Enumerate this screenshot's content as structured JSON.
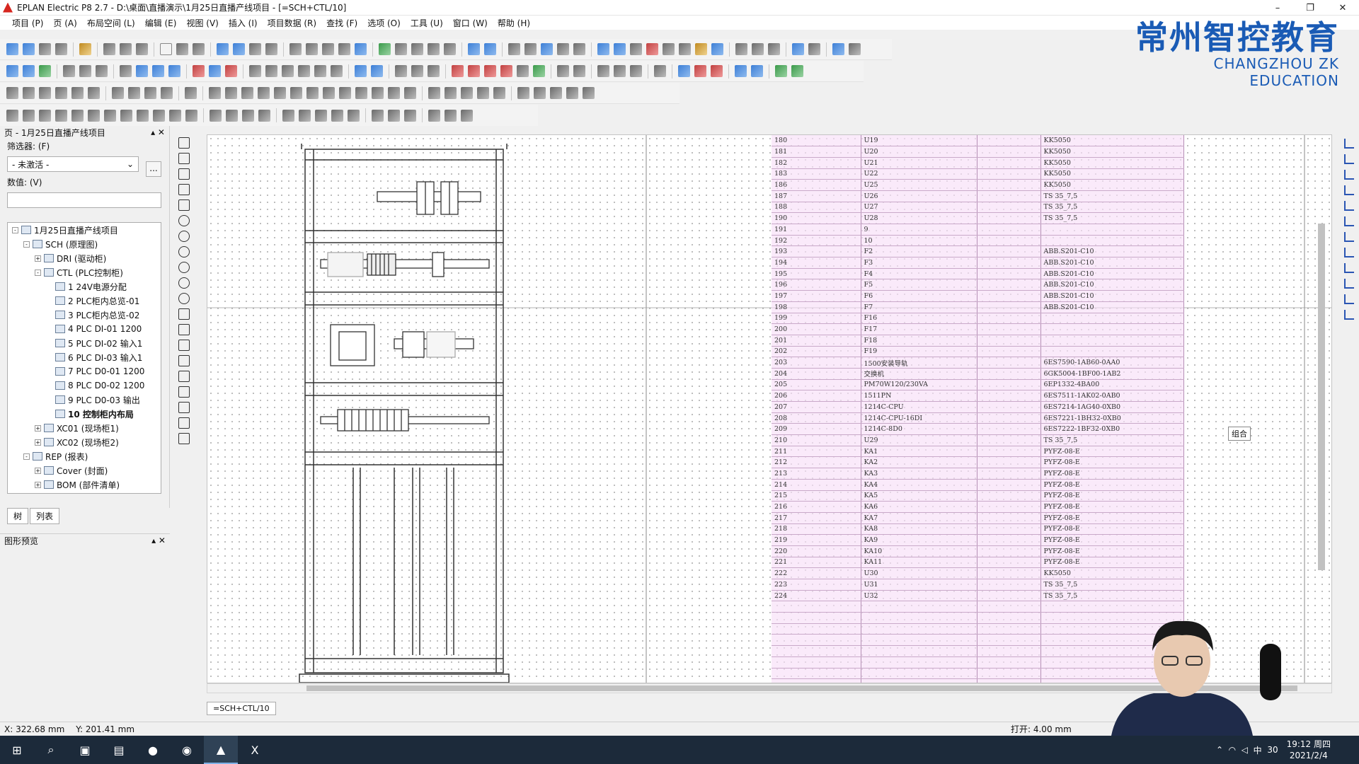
{
  "window": {
    "title": "EPLAN Electric P8 2.7 - D:\\桌面\\直播演示\\1月25日直播产线项目 - [=SCH+CTL/10]",
    "controls": [
      "–",
      "❐",
      "✕"
    ]
  },
  "menu": [
    "项目 (P)",
    "页 (A)",
    "布局空间 (L)",
    "编辑 (E)",
    "视图 (V)",
    "插入 (I)",
    "项目数据 (R)",
    "查找 (F)",
    "选项 (O)",
    "工具 (U)",
    "窗口 (W)",
    "帮助 (H)"
  ],
  "logo": {
    "cn": "常州智控教育",
    "en": "CHANGZHOU ZK EDUCATION",
    "color": "#1a5bb5"
  },
  "pages_panel": {
    "title": "页 - 1月25日直播产线项目",
    "filter_label": "筛选器: (F)",
    "filter_value": "- 未激活 -",
    "more_button": "...",
    "value_label": "数值: (V)",
    "tree": [
      {
        "label": "1月25日直播产线项目",
        "level": 0,
        "exp": "-"
      },
      {
        "label": "SCH (原理图)",
        "level": 1,
        "exp": "-"
      },
      {
        "label": "DRI (驱动柜)",
        "level": 2,
        "exp": "+"
      },
      {
        "label": "CTL (PLC控制柜)",
        "level": 2,
        "exp": "-"
      },
      {
        "label": "1 24V电源分配",
        "level": 3,
        "exp": ""
      },
      {
        "label": "2 PLC柜内总览-01",
        "level": 3,
        "exp": ""
      },
      {
        "label": "3 PLC柜内总览-02",
        "level": 3,
        "exp": ""
      },
      {
        "label": "4 PLC DI-01 1200",
        "level": 3,
        "exp": ""
      },
      {
        "label": "5 PLC DI-02 输入1",
        "level": 3,
        "exp": ""
      },
      {
        "label": "6 PLC DI-03 输入1",
        "level": 3,
        "exp": ""
      },
      {
        "label": "7 PLC D0-01 1200",
        "level": 3,
        "exp": ""
      },
      {
        "label": "8 PLC D0-02 1200",
        "level": 3,
        "exp": ""
      },
      {
        "label": "9 PLC D0-03 输出",
        "level": 3,
        "exp": ""
      },
      {
        "label": "10 控制柜内布局",
        "level": 3,
        "exp": "",
        "selected": true
      },
      {
        "label": "XC01 (现场柜1)",
        "level": 2,
        "exp": "+"
      },
      {
        "label": "XC02 (现场柜2)",
        "level": 2,
        "exp": "+"
      },
      {
        "label": "REP (报表)",
        "level": 1,
        "exp": "-"
      },
      {
        "label": "Cover (封面)",
        "level": 2,
        "exp": "+"
      },
      {
        "label": "BOM (部件清单)",
        "level": 2,
        "exp": "+"
      }
    ],
    "tabs": [
      "树",
      "列表"
    ]
  },
  "preview_panel": {
    "title": "图形预览"
  },
  "page_tab": "=SCH+CTL/10",
  "tooltip": "组合",
  "bom_rows": [
    [
      "180",
      "U19",
      "KK5050"
    ],
    [
      "181",
      "U20",
      "KK5050"
    ],
    [
      "182",
      "U21",
      "KK5050"
    ],
    [
      "183",
      "U22",
      "KK5050"
    ],
    [
      "186",
      "U25",
      "KK5050"
    ],
    [
      "187",
      "U26",
      "TS 35_7,5"
    ],
    [
      "188",
      "U27",
      "TS 35_7,5"
    ],
    [
      "190",
      "U28",
      "TS 35_7,5"
    ],
    [
      "191",
      "9",
      ""
    ],
    [
      "192",
      "10",
      ""
    ],
    [
      "193",
      "F2",
      "ABB.S201-C10"
    ],
    [
      "194",
      "F3",
      "ABB.S201-C10"
    ],
    [
      "195",
      "F4",
      "ABB.S201-C10"
    ],
    [
      "196",
      "F5",
      "ABB.S201-C10"
    ],
    [
      "197",
      "F6",
      "ABB.S201-C10"
    ],
    [
      "198",
      "F7",
      "ABB.S201-C10"
    ],
    [
      "199",
      "F16",
      ""
    ],
    [
      "200",
      "F17",
      ""
    ],
    [
      "201",
      "F18",
      ""
    ],
    [
      "202",
      "F19",
      ""
    ],
    [
      "203",
      "1500安装导轨",
      "6ES7590-1AB60-0AA0"
    ],
    [
      "204",
      "交换机",
      "6GK5004-1BF00-1AB2"
    ],
    [
      "205",
      "PM70W120/230VA",
      "6EP1332-4BA00"
    ],
    [
      "206",
      "1511PN",
      "6ES7511-1AK02-0AB0"
    ],
    [
      "207",
      "1214C-CPU",
      "6ES7214-1AG40-0XB0"
    ],
    [
      "208",
      "1214C-CPU-16DI",
      "6ES7221-1BH32-0XB0"
    ],
    [
      "209",
      "1214C-8D0",
      "6ES7222-1BF32-0XB0"
    ],
    [
      "210",
      "U29",
      "TS 35_7,5"
    ],
    [
      "211",
      "KA1",
      "PYFZ-08-E"
    ],
    [
      "212",
      "KA2",
      "PYFZ-08-E"
    ],
    [
      "213",
      "KA3",
      "PYFZ-08-E"
    ],
    [
      "214",
      "KA4",
      "PYFZ-08-E"
    ],
    [
      "215",
      "KA5",
      "PYFZ-08-E"
    ],
    [
      "216",
      "KA6",
      "PYFZ-08-E"
    ],
    [
      "217",
      "KA7",
      "PYFZ-08-E"
    ],
    [
      "218",
      "KA8",
      "PYFZ-08-E"
    ],
    [
      "219",
      "KA9",
      "PYFZ-08-E"
    ],
    [
      "220",
      "KA10",
      "PYFZ-08-E"
    ],
    [
      "221",
      "KA11",
      "PYFZ-08-E"
    ],
    [
      "222",
      "U30",
      "KK5050"
    ],
    [
      "223",
      "U31",
      "TS 35_7,5"
    ],
    [
      "224",
      "U32",
      "TS 35_7,5"
    ],
    [
      "",
      "",
      ""
    ],
    [
      "",
      "",
      ""
    ],
    [
      "",
      "",
      ""
    ],
    [
      "",
      "",
      ""
    ],
    [
      "",
      "",
      ""
    ],
    [
      "",
      "",
      ""
    ],
    [
      "",
      "",
      ""
    ],
    [
      "",
      "",
      ""
    ]
  ],
  "status": {
    "x": "X: 322.68 mm",
    "y": "Y: 201.41 mm",
    "snap": "打开: 4.00 mm"
  },
  "taskbar": {
    "time": "19:12 周四",
    "date": "2021/2/4",
    "ime": "中",
    "badge": "30"
  }
}
